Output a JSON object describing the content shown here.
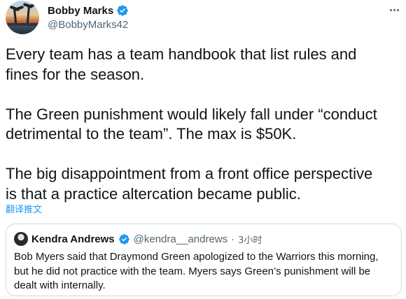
{
  "tweet": {
    "author_name": "Bobby Marks",
    "author_handle": "@BobbyMarks42",
    "text": "Every team has a team handbook that list rules and\nfines for the season.\n\nThe Green punishment would likely fall under “conduct\ndetrimental to the team”. The max is $50K.\n\nThe big disappointment from a front office perspective\nis that a practice altercation became public.",
    "translate_label": "翻译推文",
    "more_icon": "more-horizontal-icon"
  },
  "quoted_tweet": {
    "author_name": "Kendra Andrews",
    "author_handle": "@kendra__andrews",
    "separator": "·",
    "time": "3小时",
    "text": "Bob Myers said that Draymond Green apologized to the Warriors this morning,\nbut he did not practice with the team. Myers says Green’s punishment will be\ndealt with internally."
  },
  "colors": {
    "text_primary": "#0f1419",
    "text_secondary": "#536471",
    "link_blue": "#1d9bf0",
    "verified_blue": "#1d9bf0",
    "border": "#cfd9de"
  }
}
